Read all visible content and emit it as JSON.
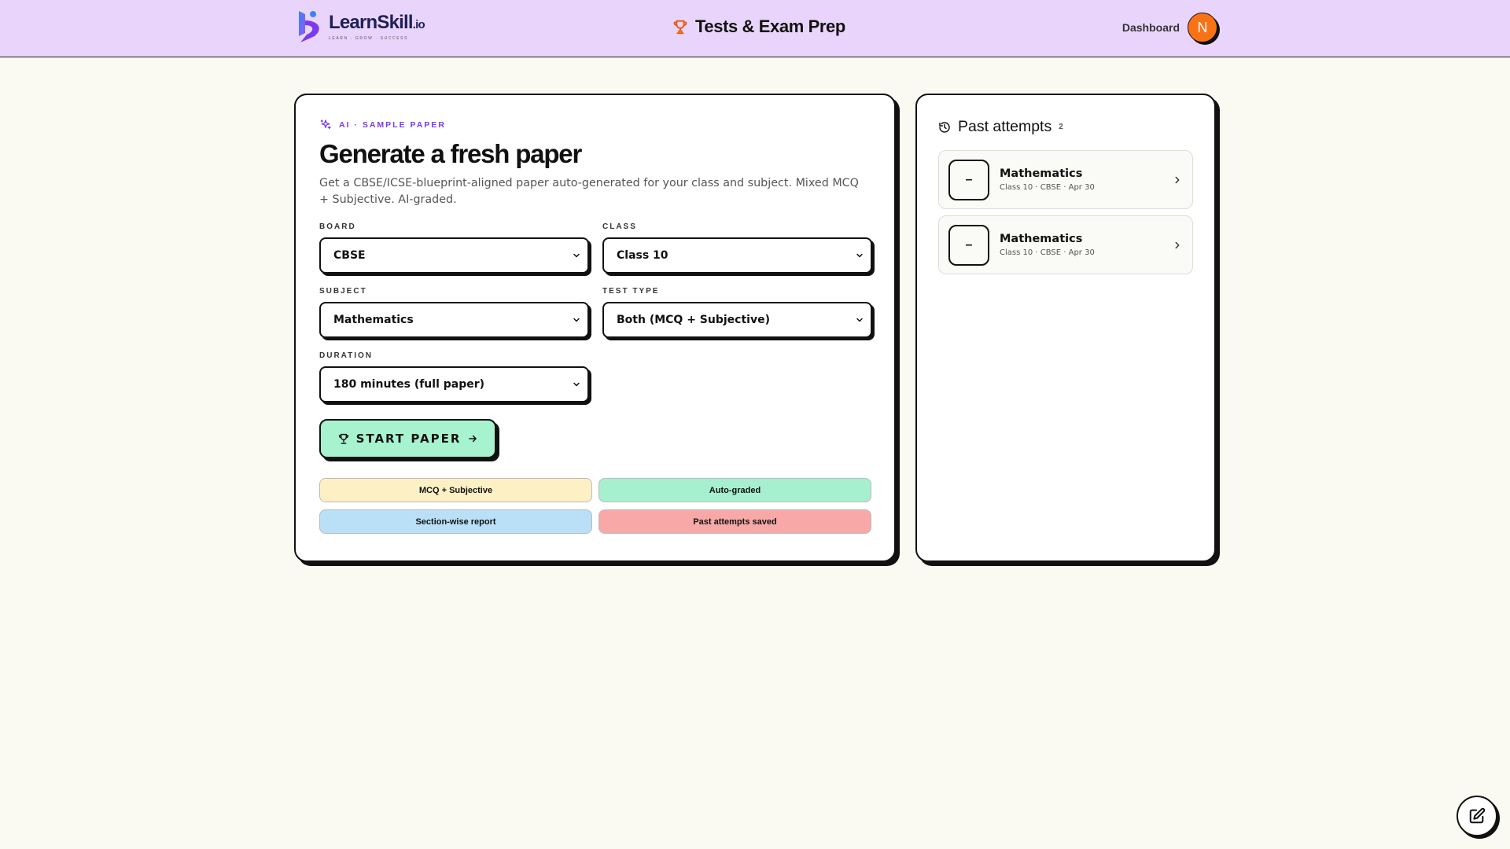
{
  "header": {
    "logo_word": "LearnSkill",
    "logo_tld": ".io",
    "logo_tagline": "LEARN · GROW · SUCCESS",
    "title": "Tests & Exam Prep",
    "dashboard_link": "Dashboard",
    "avatar_initial": "N",
    "avatar_color": "#f97316"
  },
  "generator": {
    "eyebrow": "AI · SAMPLE PAPER",
    "title": "Generate a fresh paper",
    "description": "Get a CBSE/ICSE-blueprint-aligned paper auto-generated for your class and subject. Mixed MCQ + Subjective. AI-graded.",
    "fields": {
      "board": {
        "label": "BOARD",
        "value": "CBSE"
      },
      "class": {
        "label": "CLASS",
        "value": "Class 10"
      },
      "subject": {
        "label": "SUBJECT",
        "value": "Mathematics"
      },
      "test_type": {
        "label": "TEST TYPE",
        "value": "Both (MCQ + Subjective)"
      },
      "duration": {
        "label": "DURATION",
        "value": "180 minutes (full paper)"
      }
    },
    "start_button": "START PAPER",
    "chips": [
      {
        "label": "MCQ + Subjective",
        "color": "#fdf0c4"
      },
      {
        "label": "Auto-graded",
        "color": "#a7f0cf"
      },
      {
        "label": "Section-wise report",
        "color": "#bae0f8"
      },
      {
        "label": "Past attempts saved",
        "color": "#f9a8a8"
      }
    ]
  },
  "past_attempts": {
    "title": "Past attempts",
    "count": "2",
    "items": [
      {
        "score": "–",
        "subject": "Mathematics",
        "meta": "Class 10 · CBSE · Apr 30"
      },
      {
        "score": "–",
        "subject": "Mathematics",
        "meta": "Class 10 · CBSE · Apr 30"
      }
    ]
  },
  "colors": {
    "header_bg": "#e9d5fb",
    "page_bg": "#fbfaf2",
    "accent_purple": "#7c3aed",
    "start_button_bg": "#a7f3d0",
    "trophy": "#ea580c"
  }
}
